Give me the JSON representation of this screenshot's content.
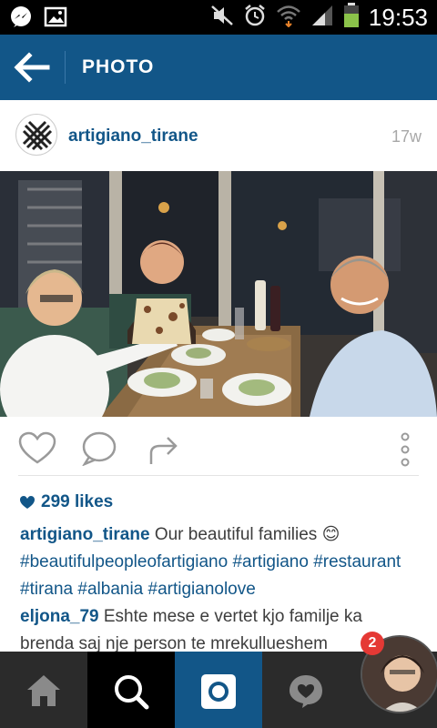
{
  "status_bar": {
    "time": "19:53",
    "icons": [
      "messenger-icon",
      "gallery-icon",
      "mute-icon",
      "alarm-icon",
      "wifi-icon",
      "signal-icon",
      "battery-icon"
    ]
  },
  "header": {
    "title": "PHOTO",
    "color": "#125688"
  },
  "post": {
    "username": "artigiano_tirane",
    "time_ago": "17w",
    "likes": "299 likes",
    "caption": {
      "author": "artigiano_tirane",
      "text": " Our beautiful families ",
      "emoji": "😊",
      "hashtags": [
        "#beautifulpeopleofartigiano",
        "#artigiano",
        "#restaurant",
        "#tirana",
        "#albania",
        "#artigianolove"
      ]
    },
    "comment": {
      "author": "eljona_79",
      "text": " Eshte mese e vertet kjo familje ka brenda saj nje person te mrekullueshem"
    }
  },
  "nav": {
    "items": [
      "home-icon",
      "search-icon",
      "camera-icon",
      "activity-icon"
    ]
  },
  "chat_head": {
    "badge": "2"
  }
}
